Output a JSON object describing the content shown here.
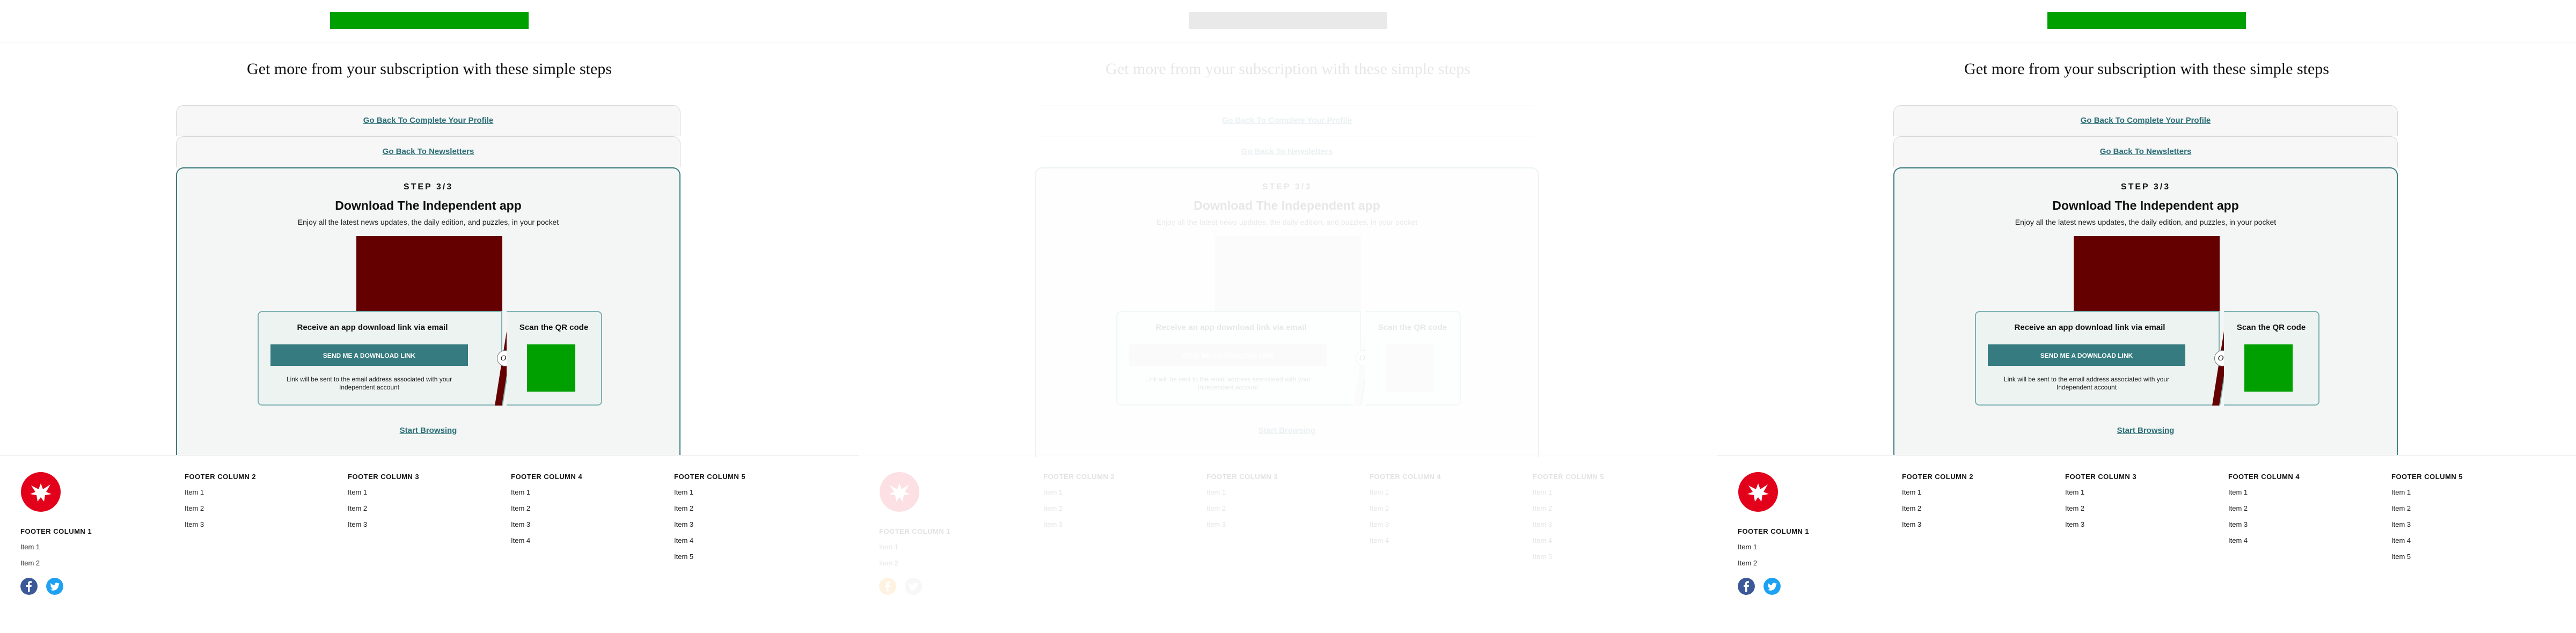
{
  "page": {
    "title": "Get more from your subscription with these simple steps",
    "link_profile": "Go Back To Complete Your Profile",
    "link_newsletters": "Go Back To Newsletters",
    "step": {
      "label": "STEP 3/3",
      "title": "Download The Independent app",
      "description": "Enjoy all the latest news updates, the daily edition, and puzzles, in your pocket",
      "email_title": "Receive an app download link via email",
      "send_button": "SEND ME A DOWNLOAD LINK",
      "email_note": "Link will be sent to the email address associated with your Independent account",
      "or_label": "Or",
      "qr_title": "Scan the QR code",
      "start_browsing": "Start Browsing"
    }
  },
  "footer": {
    "columns": [
      {
        "title": "FOOTER COLUMN 1",
        "items": [
          "Item 1",
          "Item 2"
        ]
      },
      {
        "title": "FOOTER COLUMN 2",
        "items": [
          "Item 1",
          "Item 2",
          "Item 3"
        ]
      },
      {
        "title": "FOOTER COLUMN 3",
        "items": [
          "Item 1",
          "Item 2",
          "Item 3"
        ]
      },
      {
        "title": "FOOTER COLUMN 4",
        "items": [
          "Item 1",
          "Item 2",
          "Item 3",
          "Item 4"
        ]
      },
      {
        "title": "FOOTER COLUMN 5",
        "items": [
          "Item 1",
          "Item 2",
          "Item 3",
          "Item 4",
          "Item 5"
        ]
      }
    ],
    "social_icons": [
      "facebook-icon",
      "twitter-icon"
    ]
  },
  "frames": [
    {
      "name": "frame-1",
      "faded": false
    },
    {
      "name": "frame-2",
      "faded": true
    },
    {
      "name": "frame-3",
      "faded": false
    }
  ],
  "colors": {
    "logo_bar": "#00a000",
    "accent": "#357b7f",
    "link": "#2d6f78",
    "card_border": "#3d7b7e",
    "app_image": "#640000",
    "qr_code": "#00a000",
    "brand_red": "#e2001a",
    "facebook": "#3b5998",
    "twitter": "#1da1f2"
  }
}
